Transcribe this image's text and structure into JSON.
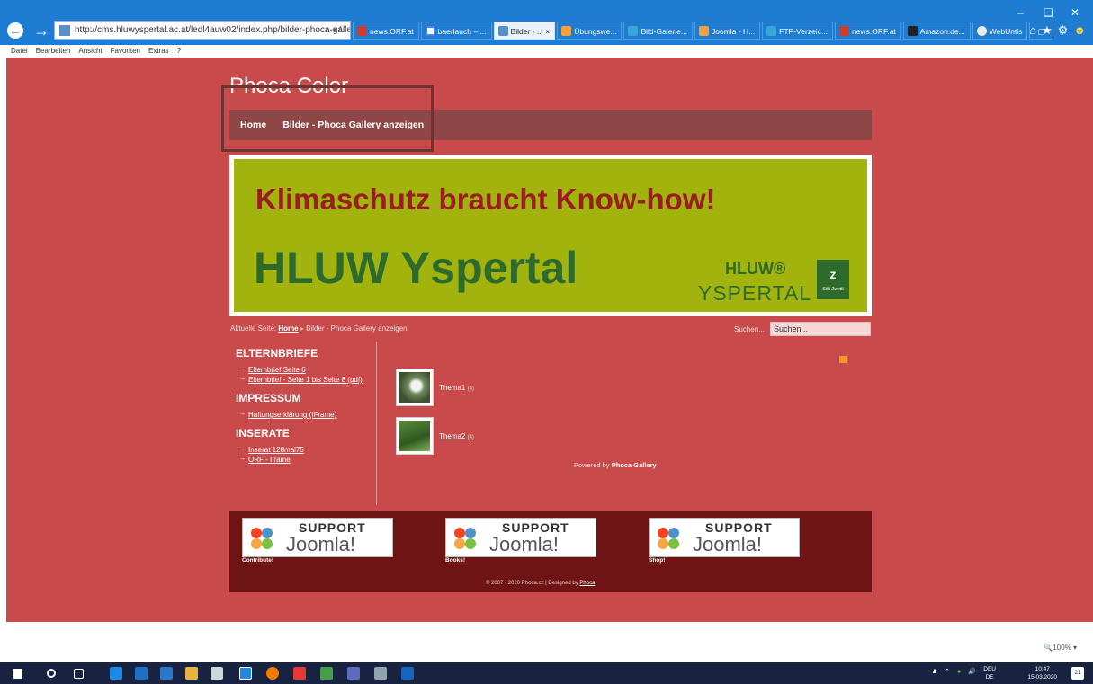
{
  "browser": {
    "address": "http://cms.hluwyspertal.ac.at/ledl4auw02/index.php/bilder-phoca-gallery",
    "address_controls": "⌕ ▾ ↻",
    "tabs": [
      {
        "label": "news.ORF.at",
        "color": "#d03b2a"
      },
      {
        "label": "baerlauch – ...",
        "color": "#4285f4"
      },
      {
        "label": "Bilder - ...  ×",
        "color": "#5a8fc9",
        "active": true
      },
      {
        "label": "Übungswe...",
        "color": "#f2a13b"
      },
      {
        "label": "Bild-Galerie...",
        "color": "#37a6d8"
      },
      {
        "label": "Joomla - H...",
        "color": "#f2a13b"
      },
      {
        "label": "FTP-Verzeic...",
        "color": "#37a6d8"
      },
      {
        "label": "news.ORF.at",
        "color": "#d03b2a"
      },
      {
        "label": "Amazon.de...",
        "color": "#222222"
      },
      {
        "label": "WebUntis",
        "color": "#eaeaea"
      }
    ],
    "menu": [
      "Datei",
      "Bearbeiten",
      "Ansicht",
      "Favoriten",
      "Extras",
      "?"
    ],
    "zoom": "🔍100%  ▾"
  },
  "site": {
    "title": "Phoca Color",
    "nav": [
      "Home",
      "Bilder - Phoca Gallery anzeigen"
    ],
    "banner": {
      "line1": "Klimaschutz braucht Know-how!",
      "line2": "HLUW Yspertal",
      "logo_top": "HLUW®",
      "logo_bottom": "YSPERTAL",
      "logo_box_letter": "z",
      "logo_box_caption": "Stift Zwettl"
    },
    "breadcrumb": {
      "prefix": "Aktuelle Seite:",
      "home": "Home",
      "sep": "▸",
      "current": "Bilder - Phoca Gallery anzeigen"
    },
    "search": {
      "label": "Suchen...",
      "value": "Suchen..."
    },
    "sidebar": {
      "sections": [
        {
          "title": "ELTERNBRIEFE",
          "items": [
            "Elternbrief Seite 6",
            "Elternbrief - Seite 1 bis Seite 8 (pdf)"
          ]
        },
        {
          "title": "IMPRESSUM",
          "items": [
            "Haftungserklärung (IFrame)"
          ]
        },
        {
          "title": "INSERATE",
          "items": [
            "Inserat 128mal75",
            "ORF - Iframe"
          ]
        }
      ]
    },
    "categories": [
      {
        "label": "Thema1",
        "count": "(4)"
      },
      {
        "label": "Thema2",
        "count": "(4)"
      }
    ],
    "powered": {
      "prefix": "Powered by",
      "name": "Phoca Gallery"
    },
    "support": [
      {
        "title": "SUPPORT",
        "brand": "Joomla!",
        "caption": "Contribute!"
      },
      {
        "title": "SUPPORT",
        "brand": "Joomla!",
        "caption": "Books!"
      },
      {
        "title": "SUPPORT",
        "brand": "Joomla!",
        "caption": "Shop!"
      }
    ],
    "copyright": {
      "text": "© 2007 - 2020 Phoca.cz | Designed by",
      "link": "Phoca"
    }
  },
  "taskbar": {
    "lang_top": "DEU",
    "lang_bottom": "DE",
    "time": "10:47",
    "date": "15.03.2020",
    "notif_count": "21"
  },
  "colors": {
    "page_bg": "#c94a4a",
    "nav_bg": "#8f4646",
    "banner_bg": "#a3b30d",
    "footer_bg": "#6e1414"
  }
}
